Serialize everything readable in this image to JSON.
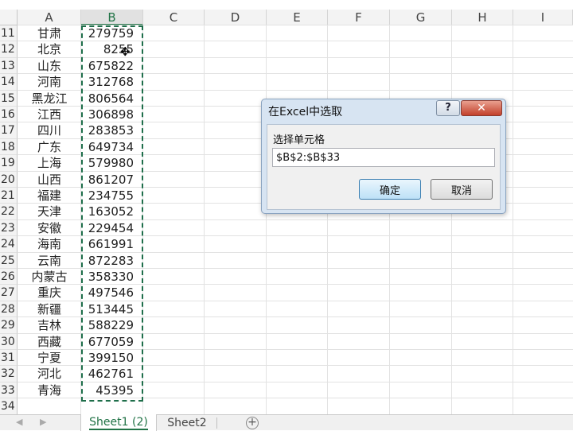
{
  "columns": [
    "A",
    "B",
    "C",
    "D",
    "E",
    "F",
    "G",
    "H",
    "I"
  ],
  "selected_column": "B",
  "rows": [
    {
      "num": "11",
      "a": "甘肃",
      "b": "279759"
    },
    {
      "num": "12",
      "a": "北京",
      "b": "8255"
    },
    {
      "num": "13",
      "a": "山东",
      "b": "675822"
    },
    {
      "num": "14",
      "a": "河南",
      "b": "312768"
    },
    {
      "num": "15",
      "a": "黑龙江",
      "b": "806564"
    },
    {
      "num": "16",
      "a": "江西",
      "b": "306898"
    },
    {
      "num": "17",
      "a": "四川",
      "b": "283853"
    },
    {
      "num": "18",
      "a": "广东",
      "b": "649734"
    },
    {
      "num": "19",
      "a": "上海",
      "b": "579980"
    },
    {
      "num": "20",
      "a": "山西",
      "b": "861207"
    },
    {
      "num": "21",
      "a": "福建",
      "b": "234755"
    },
    {
      "num": "22",
      "a": "天津",
      "b": "163052"
    },
    {
      "num": "23",
      "a": "安徽",
      "b": "229454"
    },
    {
      "num": "24",
      "a": "海南",
      "b": "661991"
    },
    {
      "num": "25",
      "a": "云南",
      "b": "872283"
    },
    {
      "num": "26",
      "a": "内蒙古",
      "b": "358330"
    },
    {
      "num": "27",
      "a": "重庆",
      "b": "497546"
    },
    {
      "num": "28",
      "a": "新疆",
      "b": "513445"
    },
    {
      "num": "29",
      "a": "吉林",
      "b": "588229"
    },
    {
      "num": "30",
      "a": "西藏",
      "b": "677059"
    },
    {
      "num": "31",
      "a": "宁夏",
      "b": "399150"
    },
    {
      "num": "32",
      "a": "河北",
      "b": "462761"
    },
    {
      "num": "33",
      "a": "青海",
      "b": "45395"
    },
    {
      "num": "34",
      "a": "",
      "b": ""
    }
  ],
  "sheet_tabs": [
    {
      "label": "Sheet1 (2)",
      "active": true
    },
    {
      "label": "Sheet2",
      "active": false
    }
  ],
  "add_sheet_glyph": "+",
  "nav_left_glyph": "◀",
  "nav_right_glyph": "▶",
  "cursor_glyph": "✥",
  "dialog": {
    "title": "在Excel中选取",
    "help_glyph": "?",
    "close_glyph": "✕",
    "label": "选择单元格",
    "input_value": "$B$2:$B$33",
    "ok_label": "确定",
    "cancel_label": "取消"
  },
  "colors": {
    "accent": "#217346",
    "marquee": "#1e6e4a",
    "close_red": "#c2402b"
  }
}
